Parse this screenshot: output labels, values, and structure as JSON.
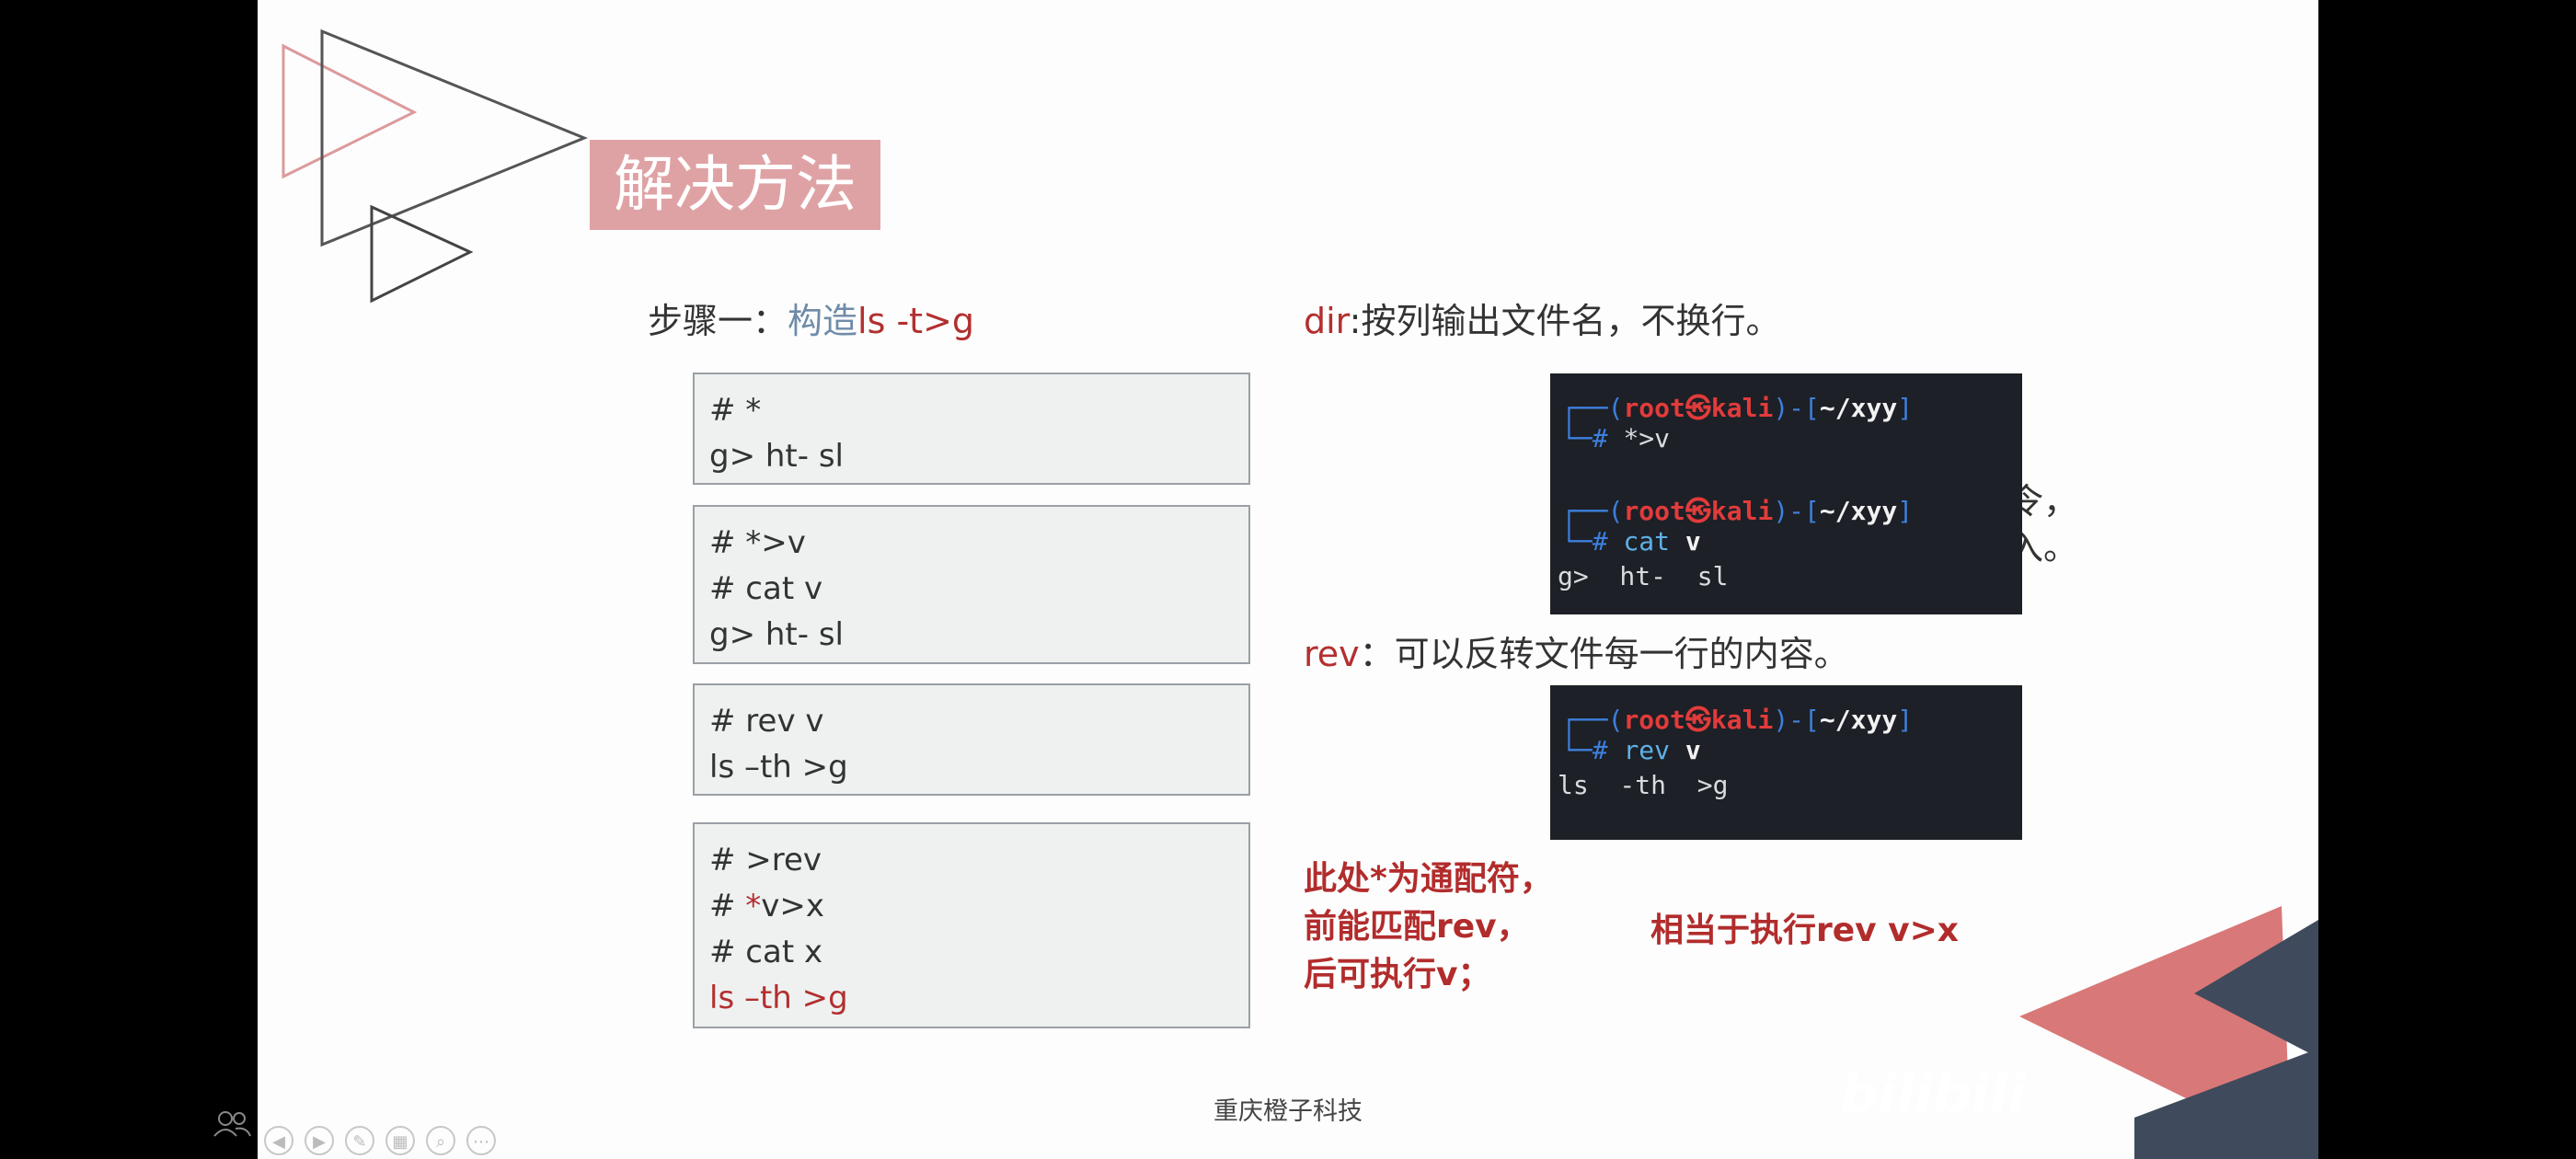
{
  "heading": "解决方法",
  "step1": {
    "label": "步骤一：",
    "highlight": "构造",
    "command": "ls -t>g"
  },
  "boxes": [
    {
      "lines": [
        "# *",
        "g> ht- sl"
      ]
    },
    {
      "lines": [
        "# *>v",
        "# cat v",
        "g> ht- sl"
      ]
    },
    {
      "lines": [
        "# rev v",
        "ls –th >g"
      ]
    },
    {
      "lines": [
        "# >rev",
        "*",
        "v>x",
        "# cat x",
        "ls –th >g"
      ],
      "prefix": "# "
    }
  ],
  "notes": {
    "dir_keyword": "dir",
    "dir_text": ":按列输出文件名，不换行。",
    "hidden_line1": "的话就会执行命令，",
    "hidden_line2": "件名作为参数传入。",
    "rev_keyword": "rev",
    "rev_text": "：可以反转文件每一行的内容。"
  },
  "terminal1": {
    "prompt_left": "┌──(",
    "user": "root",
    "at": "㉿",
    "host": "kali",
    "prompt_mid": ")-[",
    "path": "~/xyy",
    "prompt_right": "]",
    "hash": "└─#",
    "cmd1": "*>v",
    "cmd2_a": "cat",
    "cmd2_b": "v",
    "output": "g>  ht-  sl"
  },
  "terminal2": {
    "cmd_a": "rev",
    "cmd_b": "v",
    "output": "ls  -th  >g"
  },
  "explain": [
    "此处*为通配符，",
    "前能匹配rev，",
    "后可执行v；"
  ],
  "equiv": "相当于执行rev v>x",
  "footer": "重庆橙子科技",
  "watermark": "bilibili",
  "colors": {
    "accent_red": "#b32f2f",
    "heading_bg": "#dfa2a4",
    "terminal_bg": "#1d2026",
    "deco_slate": "#3f4b5c"
  }
}
